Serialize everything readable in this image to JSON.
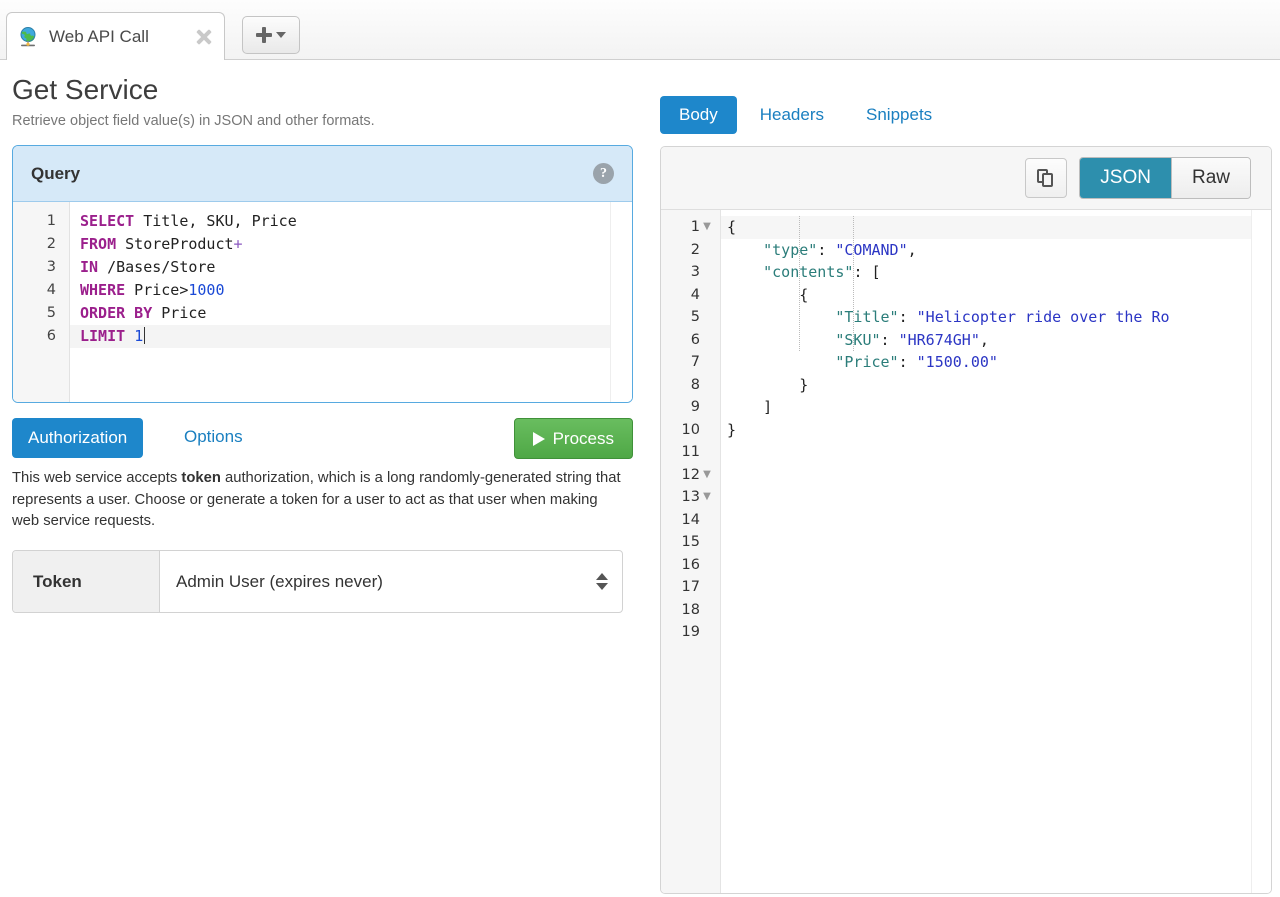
{
  "tabbar": {
    "tab_title": "Web API Call",
    "favicon": "globe-icon",
    "close_icon": "close-icon",
    "new_tab_label": "+",
    "new_tab_icon": "plus-caret-icon"
  },
  "page": {
    "title": "Get Service",
    "subtitle": "Retrieve object field value(s) in JSON and other formats."
  },
  "query": {
    "header_label": "Query",
    "help_icon": "help-icon",
    "lines": [
      {
        "n": "1",
        "tokens": [
          {
            "t": "SELECT",
            "c": "kw"
          },
          {
            "t": " Title, SKU, Price",
            "c": "plain"
          }
        ]
      },
      {
        "n": "2",
        "tokens": [
          {
            "t": "FROM",
            "c": "kw"
          },
          {
            "t": " StoreProduct",
            "c": "plain"
          },
          {
            "t": "+",
            "c": "op"
          }
        ]
      },
      {
        "n": "3",
        "tokens": [
          {
            "t": "IN",
            "c": "kw"
          },
          {
            "t": " /Bases/Store",
            "c": "plain"
          }
        ]
      },
      {
        "n": "4",
        "tokens": [
          {
            "t": "WHERE",
            "c": "kw"
          },
          {
            "t": " Price>",
            "c": "plain"
          },
          {
            "t": "1000",
            "c": "num"
          }
        ]
      },
      {
        "n": "5",
        "tokens": [
          {
            "t": "ORDER BY",
            "c": "kw"
          },
          {
            "t": " Price",
            "c": "plain"
          }
        ]
      },
      {
        "n": "6",
        "tokens": [
          {
            "t": "LIMIT",
            "c": "kw"
          },
          {
            "t": " ",
            "c": "plain"
          },
          {
            "t": "1",
            "c": "num"
          }
        ],
        "active": true,
        "caret": true
      }
    ],
    "raw_text": "SELECT Title, SKU, Price\nFROM StoreProduct+\nIN /Bases/Store\nWHERE Price>1000\nORDER BY Price\nLIMIT 1"
  },
  "actions": {
    "authorization_label": "Authorization",
    "options_label": "Options",
    "process_label": "Process",
    "process_icon": "play-icon"
  },
  "description": {
    "part1": "This web service accepts ",
    "bold": "token",
    "part2": " authorization, which is a long randomly-generated string that represents a user. Choose or generate a token for a user to act as that user when making web service requests."
  },
  "token": {
    "label": "Token",
    "selected": "Admin User (expires never)",
    "stepper_icon": "up-down-arrows-icon"
  },
  "response": {
    "tabs": [
      {
        "label": "Body",
        "active": true
      },
      {
        "label": "Headers",
        "active": false
      },
      {
        "label": "Snippets",
        "active": false
      }
    ],
    "copy_icon": "copy-icon",
    "format_toggle": [
      {
        "label": "JSON",
        "active": true
      },
      {
        "label": "Raw",
        "active": false
      }
    ],
    "lines": [
      {
        "n": "1",
        "fold": true,
        "tokens": [
          {
            "t": "{",
            "c": "jpunc"
          }
        ]
      },
      {
        "n": "2",
        "fold": false,
        "tokens": [
          {
            "t": "    ",
            "c": "jpunc"
          },
          {
            "t": "\"type\"",
            "c": "jkey"
          },
          {
            "t": ": ",
            "c": "jpunc"
          },
          {
            "t": "\"COMAND\"",
            "c": "jstr"
          },
          {
            "t": ",",
            "c": "jpunc"
          }
        ]
      },
      {
        "n": "3",
        "fold": false,
        "tokens": [
          {
            "t": "    ",
            "c": "jpunc"
          },
          {
            "t": "\"contents\"",
            "c": "jkey"
          },
          {
            "t": ": [",
            "c": "jpunc"
          }
        ]
      },
      {
        "n": "4",
        "fold": false,
        "tokens": [
          {
            "t": "        {",
            "c": "jpunc"
          }
        ]
      },
      {
        "n": "5",
        "fold": false,
        "tokens": [
          {
            "t": "            ",
            "c": "jpunc"
          },
          {
            "t": "\"Title\"",
            "c": "jkey"
          },
          {
            "t": ": ",
            "c": "jpunc"
          },
          {
            "t": "\"Helicopter ride over the Ro",
            "c": "jstr"
          }
        ]
      },
      {
        "n": "6",
        "fold": false,
        "tokens": [
          {
            "t": "            ",
            "c": "jpunc"
          },
          {
            "t": "\"SKU\"",
            "c": "jkey"
          },
          {
            "t": ": ",
            "c": "jpunc"
          },
          {
            "t": "\"HR674GH\"",
            "c": "jstr"
          },
          {
            "t": ",",
            "c": "jpunc"
          }
        ]
      },
      {
        "n": "7",
        "fold": false,
        "tokens": [
          {
            "t": "            ",
            "c": "jpunc"
          },
          {
            "t": "\"Price\"",
            "c": "jkey"
          },
          {
            "t": ": ",
            "c": "jpunc"
          },
          {
            "t": "\"1500.00\"",
            "c": "jstr"
          }
        ]
      },
      {
        "n": "8",
        "fold": false,
        "tokens": [
          {
            "t": "        }",
            "c": "jpunc"
          }
        ]
      },
      {
        "n": "9",
        "fold": false,
        "tokens": [
          {
            "t": "    ]",
            "c": "jpunc"
          }
        ]
      },
      {
        "n": "10",
        "fold": false,
        "tokens": [
          {
            "t": "}",
            "c": "jpunc"
          }
        ]
      },
      {
        "n": "11",
        "fold": false,
        "tokens": []
      },
      {
        "n": "12",
        "fold": true,
        "tokens": []
      },
      {
        "n": "13",
        "fold": true,
        "tokens": []
      },
      {
        "n": "14",
        "fold": false,
        "tokens": []
      },
      {
        "n": "15",
        "fold": false,
        "tokens": []
      },
      {
        "n": "16",
        "fold": false,
        "tokens": []
      },
      {
        "n": "17",
        "fold": false,
        "tokens": []
      },
      {
        "n": "18",
        "fold": false,
        "tokens": []
      },
      {
        "n": "19",
        "fold": false,
        "tokens": []
      }
    ],
    "payload": {
      "type": "COMAND",
      "contents": [
        {
          "Title": "Helicopter ride over the Ro",
          "SKU": "HR674GH",
          "Price": "1500.00"
        }
      ]
    }
  },
  "colors": {
    "accent_blue": "#1e87cb",
    "link_blue": "#1a7fc0",
    "process_green": "#4fa846",
    "toggle_teal": "#2d8fad",
    "query_header_bg": "#d6e9f8",
    "query_border": "#57aae0"
  }
}
